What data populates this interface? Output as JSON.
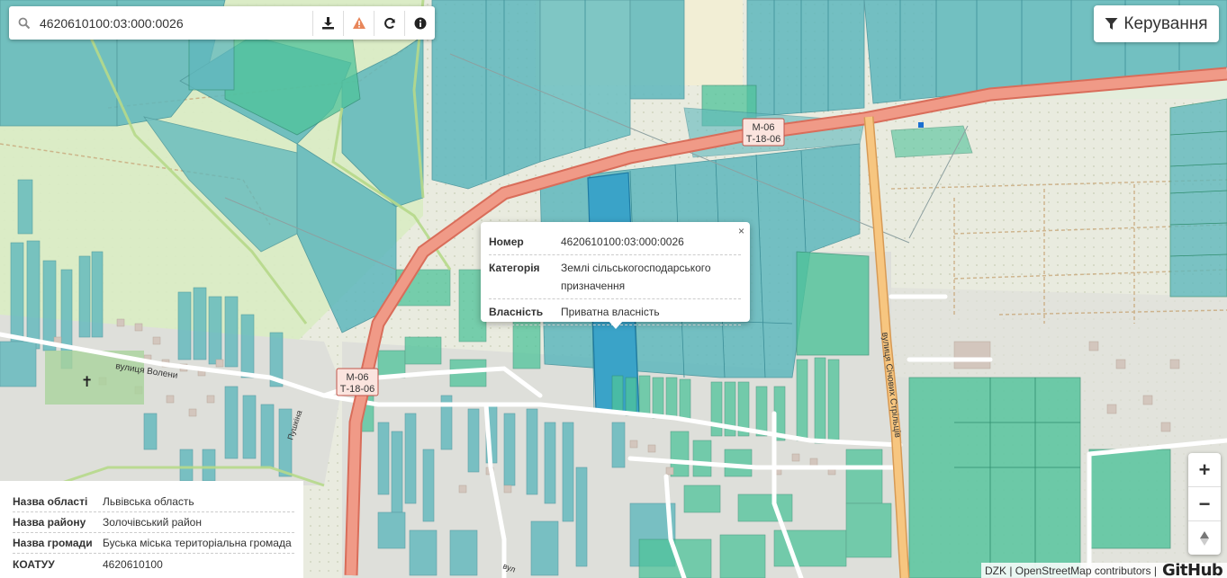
{
  "search": {
    "value": "4620610100:03:000:0026",
    "buttons": [
      "download-icon",
      "warning-icon",
      "refresh-icon",
      "info-icon"
    ]
  },
  "control": {
    "label": "Керування",
    "icon": "filter-icon"
  },
  "popup": {
    "close_label": "×",
    "rows": [
      {
        "key": "Номер",
        "value": "4620610100:03:000:0026"
      },
      {
        "key": "Категорія",
        "value": "Землі сільськогосподарського призначення"
      },
      {
        "key": "Власність",
        "value": "Приватна власність"
      }
    ]
  },
  "info_panel": {
    "rows": [
      {
        "key": "Назва області",
        "value": "Львівська область"
      },
      {
        "key": "Назва району",
        "value": "Золочівський район"
      },
      {
        "key": "Назва громади",
        "value": "Буська міська територіальна громада"
      },
      {
        "key": "КОАТУУ",
        "value": "4620610100"
      }
    ]
  },
  "map_labels": {
    "road_shield_top_1": "М-06",
    "road_shield_bottom_1": "Т-18-06",
    "road_shield_top_2": "М-06",
    "road_shield_bottom_2": "Т-18-06",
    "street_voli": "вулиця Волени",
    "street_sichovykh": "вулиця Січових Стрільців",
    "street_small": "Пушкіна",
    "street_bottom": "вул"
  },
  "zoom": {
    "in": "+",
    "out": "−",
    "reset": "▲"
  },
  "attribution": {
    "text": "DZK | OpenStreetMap contributors |",
    "github": "GitHub"
  },
  "colors": {
    "parcel": "#5fb8bd",
    "parcel_green": "#4fc39a",
    "parcel_selected": "#3aa3c8",
    "road_main": "#ee8a78",
    "road_secondary": "#f5bd74",
    "farmland": "#ecede2",
    "meadow": "#d6ecb6"
  }
}
